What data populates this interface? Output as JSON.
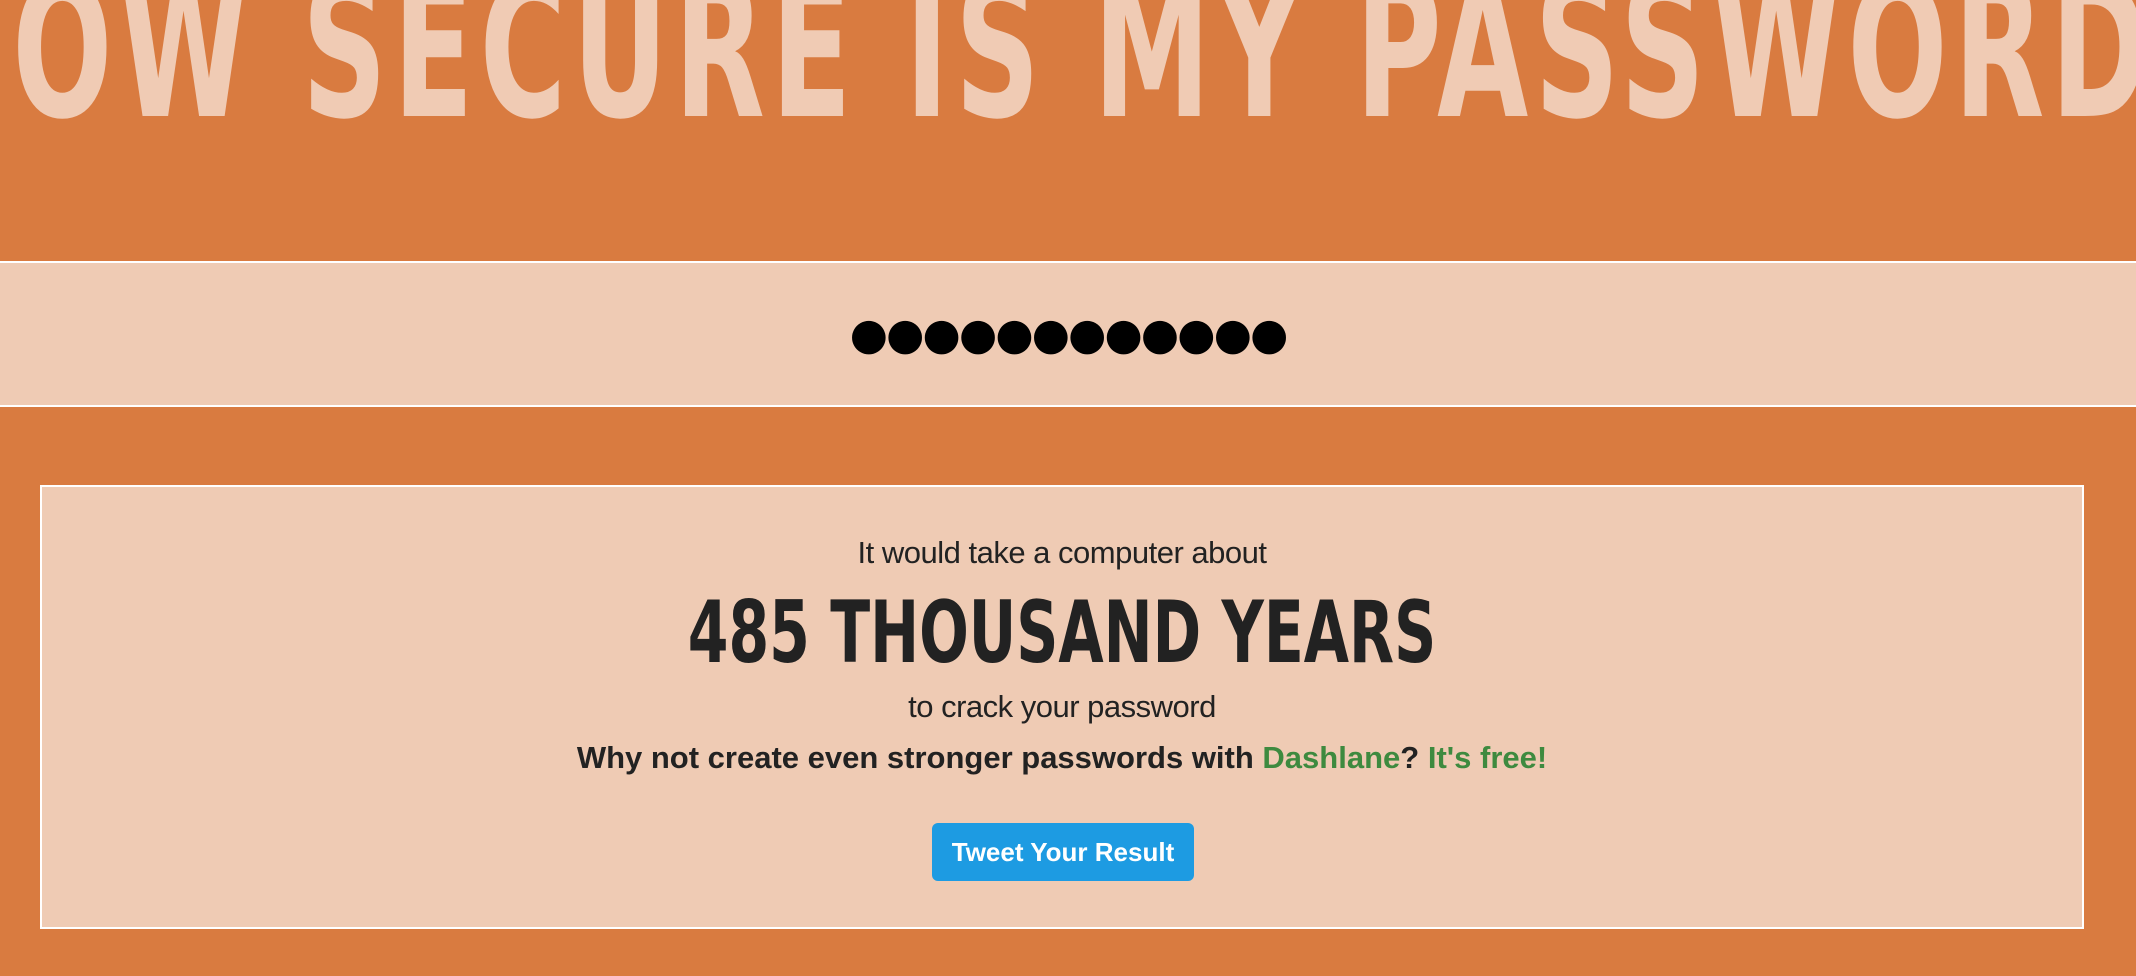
{
  "header": {
    "title": "HOW SECURE IS MY PASSWORD?"
  },
  "password": {
    "value": "●●●●●●●●●●●●"
  },
  "result": {
    "intro": "It would take a computer about",
    "time": "485 THOUSAND YEARS",
    "outro": "to crack your password",
    "promo_prefix": "Why not create even stronger passwords with ",
    "promo_link": "Dashlane",
    "promo_mid": "? ",
    "promo_free": "It's free!",
    "tweet_label": "Tweet Your Result"
  },
  "colors": {
    "background": "#d97b40",
    "panel": "#efcbb4",
    "title_text": "#f0cbb4",
    "link_green": "#3e8a3f",
    "tweet_blue": "#1d9be2"
  }
}
